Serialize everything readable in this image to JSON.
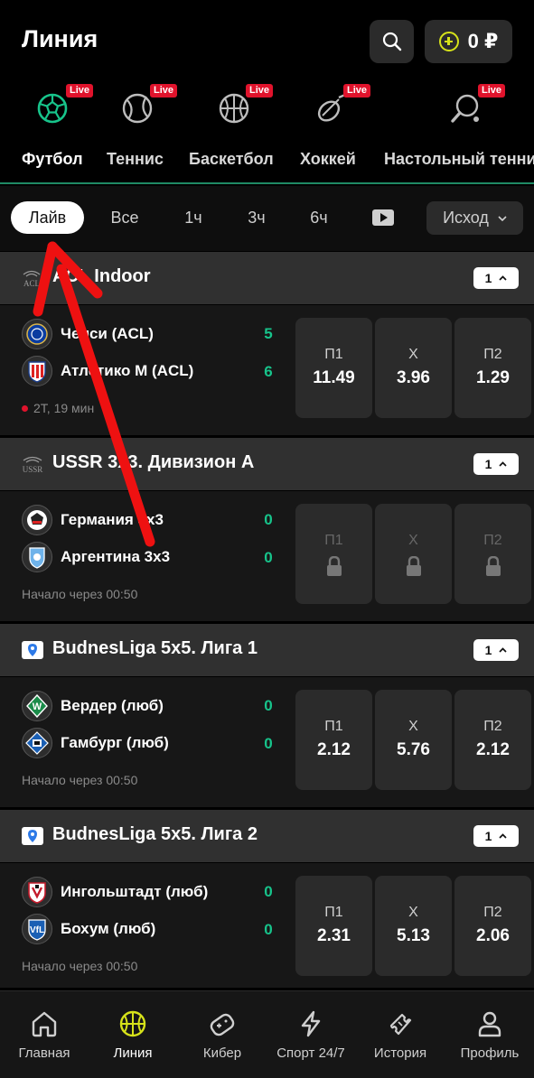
{
  "header": {
    "title": "Линия",
    "balance": "0 ₽"
  },
  "sports": [
    {
      "label": "Футбол",
      "badge": "Live",
      "icon": "football-icon"
    },
    {
      "label": "Теннис",
      "badge": "Live",
      "icon": "tennis-icon"
    },
    {
      "label": "Баскетбол",
      "badge": "Live",
      "icon": "basketball-icon"
    },
    {
      "label": "Хоккей",
      "badge": "Live",
      "icon": "hockey-icon"
    },
    {
      "label": "Настольный теннис",
      "badge": "Live",
      "icon": "table-tennis-icon"
    }
  ],
  "filters": {
    "chips": [
      "Лайв",
      "Все",
      "1ч",
      "3ч",
      "6ч"
    ],
    "outcome": "Исход"
  },
  "leagues": [
    {
      "name": "ACL Indoor",
      "logo_text": "ACL",
      "count": "1",
      "event": {
        "team1": "Челси (ACL)",
        "team2": "Атлетико М (ACL)",
        "score1": "5",
        "score2": "6",
        "status": "2Т, 19 мин",
        "odds": [
          {
            "label": "П1",
            "value": "11.49"
          },
          {
            "label": "Х",
            "value": "3.96"
          },
          {
            "label": "П2",
            "value": "1.29"
          }
        ]
      }
    },
    {
      "name": "USSR 3x3. Дивизион А",
      "logo_text": "USSR",
      "count": "1",
      "event": {
        "team1": "Германия 3x3",
        "team2": "Аргентина 3x3",
        "score1": "0",
        "score2": "0",
        "status": "Начало через 00:50",
        "odds": [
          {
            "label": "П1",
            "value": ""
          },
          {
            "label": "Х",
            "value": ""
          },
          {
            "label": "П2",
            "value": ""
          }
        ]
      }
    },
    {
      "name": "BudnesLiga 5x5. Лига 1",
      "logo_text": "",
      "count": "1",
      "event": {
        "team1": "Вердер (люб)",
        "team2": "Гамбург (люб)",
        "score1": "0",
        "score2": "0",
        "status": "Начало через 00:50",
        "odds": [
          {
            "label": "П1",
            "value": "2.12"
          },
          {
            "label": "Х",
            "value": "5.76"
          },
          {
            "label": "П2",
            "value": "2.12"
          }
        ]
      }
    },
    {
      "name": "BudnesLiga 5x5. Лига 2",
      "logo_text": "",
      "count": "1",
      "event": {
        "team1": "Ингольштадт (люб)",
        "team2": "Бохум (люб)",
        "score1": "0",
        "score2": "0",
        "status": "Начало через 00:50",
        "odds": [
          {
            "label": "П1",
            "value": "2.31"
          },
          {
            "label": "Х",
            "value": "5.13"
          },
          {
            "label": "П2",
            "value": "2.06"
          }
        ]
      }
    }
  ],
  "bottom_nav": [
    {
      "label": "Главная",
      "icon": "home-icon"
    },
    {
      "label": "Линия",
      "icon": "basketball-icon"
    },
    {
      "label": "Кибер",
      "icon": "gamepad-icon"
    },
    {
      "label": "Спорт 24/7",
      "icon": "lightning-icon"
    },
    {
      "label": "История",
      "icon": "ticket-icon"
    },
    {
      "label": "Профиль",
      "icon": "user-icon"
    }
  ],
  "colors": {
    "accent_green": "#17c48b",
    "live_red": "#e0132c",
    "active_nav": "#d6e21a",
    "annotation_arrow": "#ee1111"
  }
}
